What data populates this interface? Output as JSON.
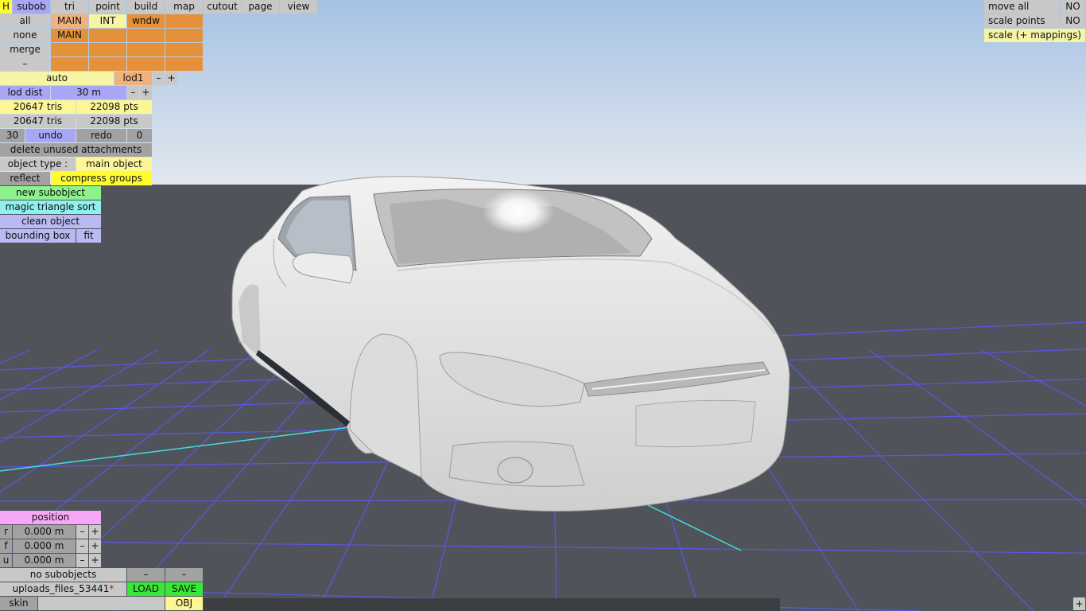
{
  "top_menu": [
    "H",
    "subob",
    "tri",
    "point",
    "build",
    "map",
    "cutout",
    "page",
    "view"
  ],
  "group_grid": {
    "rows": [
      [
        "all",
        "MAIN",
        "INT",
        "wndw"
      ],
      [
        "none",
        "MAIN",
        "",
        ""
      ],
      [
        "merge",
        "",
        "",
        ""
      ],
      [
        "–",
        "",
        "",
        ""
      ]
    ]
  },
  "lod": {
    "mode": "auto",
    "level": "lod1",
    "minus": "–",
    "plus": "+"
  },
  "lod_dist": {
    "label": "lod dist",
    "value": "30 m",
    "minus": "–",
    "plus": "+"
  },
  "counts": [
    {
      "tris": "20647 tris",
      "pts": "22098 pts"
    },
    {
      "tris": "20647 tris",
      "pts": "22098 pts"
    }
  ],
  "history": {
    "undo_count": "30",
    "undo": "undo",
    "redo": "redo",
    "redo_count": "0"
  },
  "actions": {
    "delete_unused": "delete unused attachments",
    "object_type_label": "object type :",
    "object_type_value": "main object",
    "reflect": "reflect",
    "compress_groups": "compress groups",
    "new_subobject": "new subobject",
    "magic_sort": "magic triangle sort",
    "clean_object": "clean object",
    "bounding_box": "bounding box",
    "fit": "fit"
  },
  "right_panel": {
    "move_all": "move all",
    "move_all_value": "NO",
    "scale_points": "scale points",
    "scale_points_value": "NO",
    "scale_mappings": "scale (+ mappings)"
  },
  "position": {
    "title": "position",
    "rows": [
      {
        "axis": "r",
        "value": "0.000 m"
      },
      {
        "axis": "f",
        "value": "0.000 m"
      },
      {
        "axis": "u",
        "value": "0.000 m"
      }
    ],
    "minus": "–",
    "plus": "+"
  },
  "bottom": {
    "subobjects": "no subobjects",
    "dash1": "–",
    "dash2": "–",
    "filename": "uploads_files_53441",
    "modified_mark": "*",
    "load": "LOAD",
    "save": "SAVE",
    "skin": "skin",
    "obj": "OBJ",
    "corner_plus": "+"
  },
  "colors": {
    "sky_top": "#a6c2e4",
    "sky_bottom": "#dfe6ee",
    "ground": "#505359",
    "grid": "#5b57e8",
    "axis": "#3de0e0"
  }
}
